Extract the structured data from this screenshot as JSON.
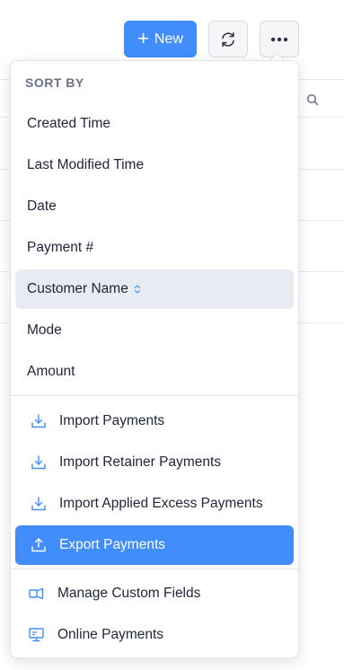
{
  "toolbar": {
    "new_label": "New",
    "new_icon": "plus-icon",
    "refresh_icon": "refresh-icon",
    "more_icon": "more-icon"
  },
  "menu": {
    "sort_by_title": "SORT BY",
    "sort_items": [
      {
        "label": "Created Time"
      },
      {
        "label": "Last Modified Time"
      },
      {
        "label": "Date"
      },
      {
        "label": "Payment #"
      },
      {
        "label": "Customer Name",
        "highlighted": true,
        "icon": "sort-arrows-icon"
      },
      {
        "label": "Mode"
      },
      {
        "label": "Amount"
      }
    ],
    "import_items": [
      {
        "label": "Import Payments",
        "icon": "download-icon"
      },
      {
        "label": "Import Retainer Payments",
        "icon": "download-icon"
      },
      {
        "label": "Import Applied Excess Payments",
        "icon": "download-icon"
      },
      {
        "label": "Export Payments",
        "icon": "upload-icon",
        "active": true
      }
    ],
    "other_items": [
      {
        "label": "Manage Custom Fields",
        "icon": "custom-fields-icon"
      },
      {
        "label": "Online Payments",
        "icon": "monitor-icon"
      }
    ]
  },
  "colors": {
    "accent": "#408dfb",
    "highlight": "#e8ebf1",
    "text": "#21263c",
    "section_title": "#6c718a"
  }
}
